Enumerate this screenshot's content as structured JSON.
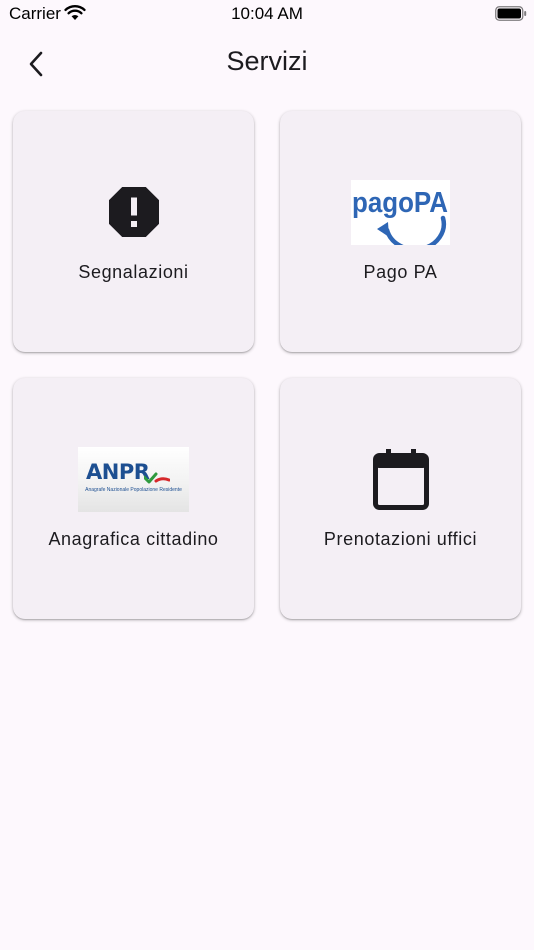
{
  "status_bar": {
    "carrier": "Carrier",
    "time": "10:04 AM"
  },
  "header": {
    "title": "Servizi",
    "back_icon": "chevron-left-icon"
  },
  "services": [
    {
      "label": "Segnalazioni",
      "icon": "alert-octagon-icon"
    },
    {
      "label": "Pago PA",
      "icon": "pagopa-logo",
      "logo_text": "pagoPA"
    },
    {
      "label": "Anagrafica cittadino",
      "icon": "anpr-logo",
      "logo_text": "ANPR",
      "logo_subtext": "Anagrafe Nazionale Popolazione Residente"
    },
    {
      "label": "Prenotazioni uffici",
      "icon": "calendar-icon"
    }
  ],
  "colors": {
    "background": "#fdf8fd",
    "card": "#f4eff5",
    "pagopa_blue": "#2e66b5",
    "anpr_blue": "#1d4f91"
  }
}
